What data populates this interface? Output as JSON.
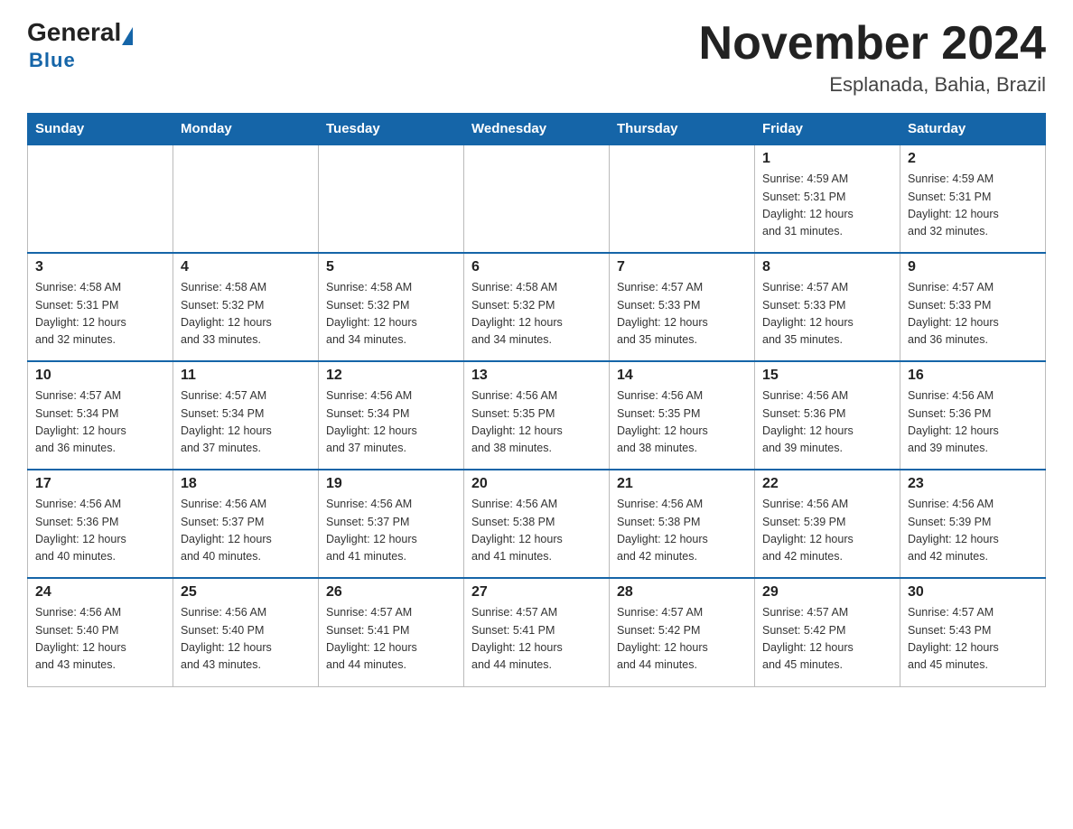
{
  "header": {
    "logo_general": "General",
    "logo_blue": "Blue",
    "month_title": "November 2024",
    "location": "Esplanada, Bahia, Brazil"
  },
  "days_of_week": [
    "Sunday",
    "Monday",
    "Tuesday",
    "Wednesday",
    "Thursday",
    "Friday",
    "Saturday"
  ],
  "weeks": [
    [
      {
        "day": "",
        "info": ""
      },
      {
        "day": "",
        "info": ""
      },
      {
        "day": "",
        "info": ""
      },
      {
        "day": "",
        "info": ""
      },
      {
        "day": "",
        "info": ""
      },
      {
        "day": "1",
        "info": "Sunrise: 4:59 AM\nSunset: 5:31 PM\nDaylight: 12 hours\nand 31 minutes."
      },
      {
        "day": "2",
        "info": "Sunrise: 4:59 AM\nSunset: 5:31 PM\nDaylight: 12 hours\nand 32 minutes."
      }
    ],
    [
      {
        "day": "3",
        "info": "Sunrise: 4:58 AM\nSunset: 5:31 PM\nDaylight: 12 hours\nand 32 minutes."
      },
      {
        "day": "4",
        "info": "Sunrise: 4:58 AM\nSunset: 5:32 PM\nDaylight: 12 hours\nand 33 minutes."
      },
      {
        "day": "5",
        "info": "Sunrise: 4:58 AM\nSunset: 5:32 PM\nDaylight: 12 hours\nand 34 minutes."
      },
      {
        "day": "6",
        "info": "Sunrise: 4:58 AM\nSunset: 5:32 PM\nDaylight: 12 hours\nand 34 minutes."
      },
      {
        "day": "7",
        "info": "Sunrise: 4:57 AM\nSunset: 5:33 PM\nDaylight: 12 hours\nand 35 minutes."
      },
      {
        "day": "8",
        "info": "Sunrise: 4:57 AM\nSunset: 5:33 PM\nDaylight: 12 hours\nand 35 minutes."
      },
      {
        "day": "9",
        "info": "Sunrise: 4:57 AM\nSunset: 5:33 PM\nDaylight: 12 hours\nand 36 minutes."
      }
    ],
    [
      {
        "day": "10",
        "info": "Sunrise: 4:57 AM\nSunset: 5:34 PM\nDaylight: 12 hours\nand 36 minutes."
      },
      {
        "day": "11",
        "info": "Sunrise: 4:57 AM\nSunset: 5:34 PM\nDaylight: 12 hours\nand 37 minutes."
      },
      {
        "day": "12",
        "info": "Sunrise: 4:56 AM\nSunset: 5:34 PM\nDaylight: 12 hours\nand 37 minutes."
      },
      {
        "day": "13",
        "info": "Sunrise: 4:56 AM\nSunset: 5:35 PM\nDaylight: 12 hours\nand 38 minutes."
      },
      {
        "day": "14",
        "info": "Sunrise: 4:56 AM\nSunset: 5:35 PM\nDaylight: 12 hours\nand 38 minutes."
      },
      {
        "day": "15",
        "info": "Sunrise: 4:56 AM\nSunset: 5:36 PM\nDaylight: 12 hours\nand 39 minutes."
      },
      {
        "day": "16",
        "info": "Sunrise: 4:56 AM\nSunset: 5:36 PM\nDaylight: 12 hours\nand 39 minutes."
      }
    ],
    [
      {
        "day": "17",
        "info": "Sunrise: 4:56 AM\nSunset: 5:36 PM\nDaylight: 12 hours\nand 40 minutes."
      },
      {
        "day": "18",
        "info": "Sunrise: 4:56 AM\nSunset: 5:37 PM\nDaylight: 12 hours\nand 40 minutes."
      },
      {
        "day": "19",
        "info": "Sunrise: 4:56 AM\nSunset: 5:37 PM\nDaylight: 12 hours\nand 41 minutes."
      },
      {
        "day": "20",
        "info": "Sunrise: 4:56 AM\nSunset: 5:38 PM\nDaylight: 12 hours\nand 41 minutes."
      },
      {
        "day": "21",
        "info": "Sunrise: 4:56 AM\nSunset: 5:38 PM\nDaylight: 12 hours\nand 42 minutes."
      },
      {
        "day": "22",
        "info": "Sunrise: 4:56 AM\nSunset: 5:39 PM\nDaylight: 12 hours\nand 42 minutes."
      },
      {
        "day": "23",
        "info": "Sunrise: 4:56 AM\nSunset: 5:39 PM\nDaylight: 12 hours\nand 42 minutes."
      }
    ],
    [
      {
        "day": "24",
        "info": "Sunrise: 4:56 AM\nSunset: 5:40 PM\nDaylight: 12 hours\nand 43 minutes."
      },
      {
        "day": "25",
        "info": "Sunrise: 4:56 AM\nSunset: 5:40 PM\nDaylight: 12 hours\nand 43 minutes."
      },
      {
        "day": "26",
        "info": "Sunrise: 4:57 AM\nSunset: 5:41 PM\nDaylight: 12 hours\nand 44 minutes."
      },
      {
        "day": "27",
        "info": "Sunrise: 4:57 AM\nSunset: 5:41 PM\nDaylight: 12 hours\nand 44 minutes."
      },
      {
        "day": "28",
        "info": "Sunrise: 4:57 AM\nSunset: 5:42 PM\nDaylight: 12 hours\nand 44 minutes."
      },
      {
        "day": "29",
        "info": "Sunrise: 4:57 AM\nSunset: 5:42 PM\nDaylight: 12 hours\nand 45 minutes."
      },
      {
        "day": "30",
        "info": "Sunrise: 4:57 AM\nSunset: 5:43 PM\nDaylight: 12 hours\nand 45 minutes."
      }
    ]
  ]
}
